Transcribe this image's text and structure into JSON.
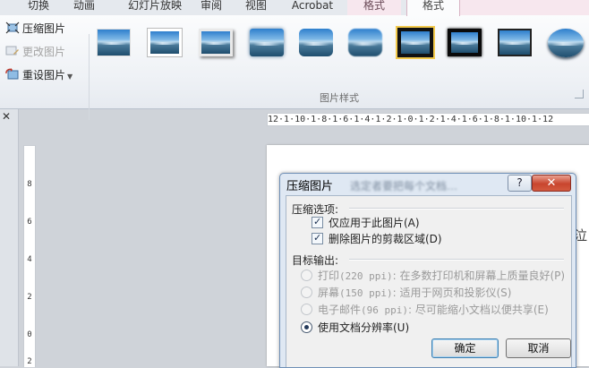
{
  "tabs": [
    {
      "label": "切换"
    },
    {
      "label": "动画"
    },
    {
      "label": "幻灯片放映"
    },
    {
      "label": "审阅"
    },
    {
      "label": "视图"
    },
    {
      "label": "Acrobat"
    },
    {
      "label": "格式"
    },
    {
      "label": "格式"
    }
  ],
  "ribbon": {
    "compress_label": "压缩图片",
    "change_label": "更改图片",
    "reset_label": "重设图片",
    "group_label": "图片样式",
    "style_count": 10
  },
  "ruler": {
    "horizontal": "12·1·10·1·8·1·6·1·4·1·2·1·0·1·2·1·4·1·6·1·8·1·10·1·12",
    "vertical_labels": [
      "8",
      "6",
      "4",
      "2",
      "0",
      "2"
    ]
  },
  "page_edge_text": "泣",
  "dialog": {
    "title": "压缩图片",
    "blurred_text": "选定者要把每个文档…",
    "help_glyph": "?",
    "close_glyph": "✕",
    "section_compress": "压缩选项:",
    "opt_apply_only": "仅应用于此图片(A)",
    "opt_delete_crop": "删除图片的剪裁区域(D)",
    "section_target": "目标输出:",
    "targets": [
      {
        "label": "打印",
        "ppi": "(220 ppi)",
        "desc": ": 在多数打印机和屏幕上质量良好(P)",
        "enabled": false,
        "selected": false
      },
      {
        "label": "屏幕",
        "ppi": "(150 ppi)",
        "desc": ": 适用于网页和投影仪(S)",
        "enabled": false,
        "selected": false
      },
      {
        "label": "电子邮件",
        "ppi": "(96 ppi)",
        "desc": ": 尽可能缩小文档以便共享(E)",
        "enabled": false,
        "selected": false
      },
      {
        "label": "使用文档分辨率(U)",
        "ppi": "",
        "desc": "",
        "enabled": true,
        "selected": true
      }
    ],
    "ok_label": "确定",
    "cancel_label": "取消"
  }
}
